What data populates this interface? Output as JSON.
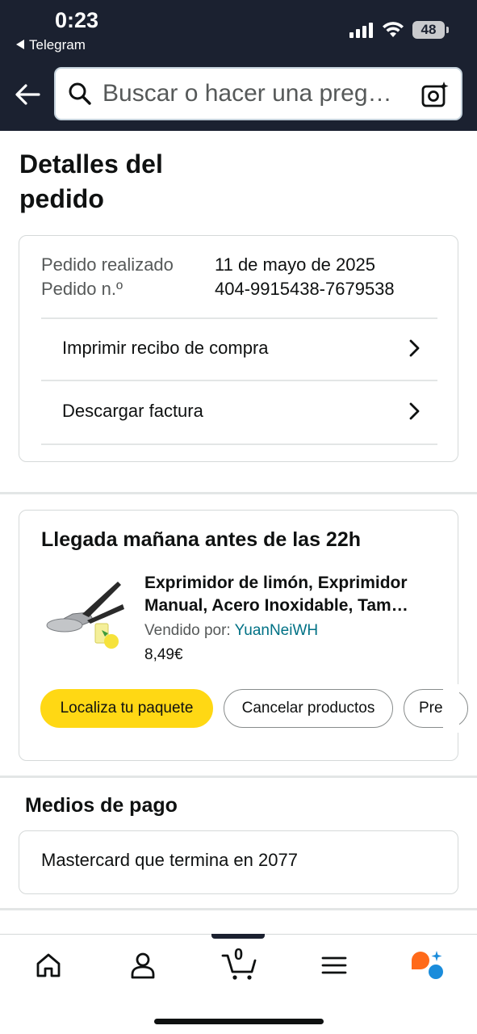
{
  "status_bar": {
    "time": "0:23",
    "back_app": "Telegram",
    "battery": "48"
  },
  "search": {
    "placeholder": "Buscar o hacer una preg…"
  },
  "page": {
    "title": "Detalles del pedido"
  },
  "order": {
    "placed_label": "Pedido realizado",
    "placed_value": "11 de mayo de 2025",
    "number_label": "Pedido n.º",
    "number_value": "404-9915438-7679538",
    "print_receipt": "Imprimir recibo de compra",
    "download_invoice": "Descargar factura"
  },
  "delivery": {
    "title": "Llegada mañana antes de las 22h",
    "product_line1": "Exprimidor de limón, Exprimidor",
    "product_line2": "Manual, Acero Inoxidable, Tam…",
    "sold_by_label": "Vendido por: ",
    "seller": "YuanNeiWH",
    "price": "8,49€",
    "btn_track": "Localiza tu paquete",
    "btn_cancel": "Cancelar productos",
    "btn_more": "Pre"
  },
  "payment": {
    "title": "Medios de pago",
    "method": "Mastercard  que termina en 2077"
  },
  "tabbar": {
    "cart_count": "0"
  },
  "colors": {
    "header_bg": "#1b2130",
    "accent_yellow": "#ffd814",
    "link": "#007185",
    "alexa_orange": "#ff6a1a",
    "alexa_blue": "#1a8cdb"
  }
}
